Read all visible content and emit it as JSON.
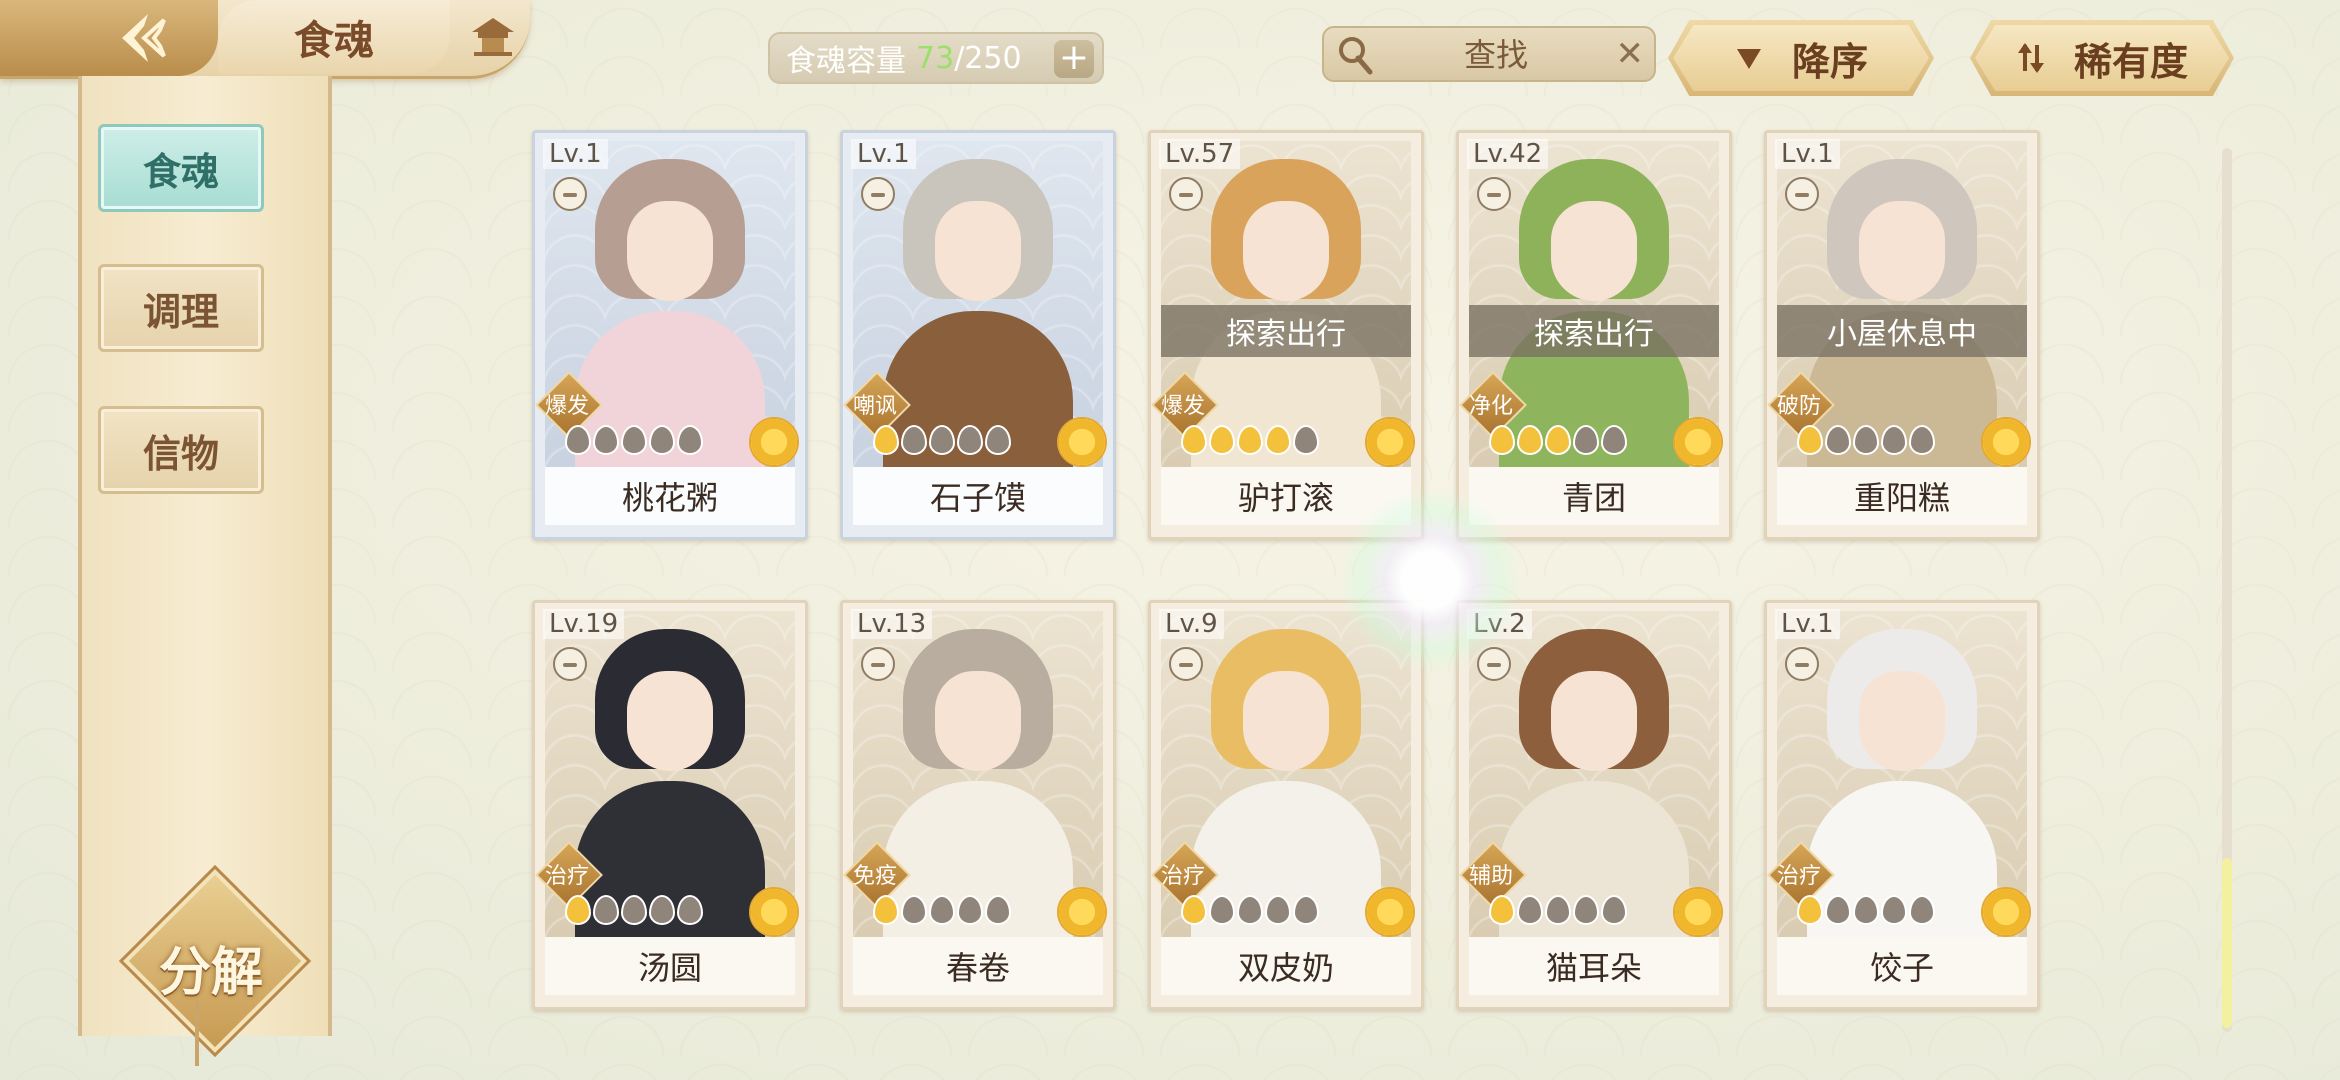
{
  "header": {
    "title": "食魂",
    "capacity_label": "食魂容量",
    "capacity_current": "73",
    "capacity_max": "/250",
    "add_label": "+"
  },
  "search": {
    "placeholder": "查找",
    "clear_label": "✕"
  },
  "sort": {
    "order_label": "降序",
    "rarity_label": "稀有度"
  },
  "sidebar": {
    "tabs": [
      "食魂",
      "调理",
      "信物"
    ],
    "active_tab": "食魂",
    "decompose_label": "分解"
  },
  "colors": {
    "accent_gold": "#c9a56a",
    "active_tab": "#a6ddd2",
    "star_on": "#f3c13c",
    "capacity_current": "#9be06a"
  },
  "cards": [
    {
      "level": "Lv.1",
      "name": "桃花粥",
      "role": "爆发",
      "status": "",
      "stars": 0,
      "theme": "blue",
      "hair": "#b79e92",
      "body": "#f1d4da"
    },
    {
      "level": "Lv.1",
      "name": "石子馍",
      "role": "嘲讽",
      "status": "",
      "stars": 1,
      "theme": "blue",
      "hair": "#c9c4bc",
      "body": "#8a5f3b"
    },
    {
      "level": "Lv.57",
      "name": "驴打滚",
      "role": "爆发",
      "status": "探索出行",
      "stars": 4,
      "theme": "normal",
      "hair": "#d9a35c",
      "body": "#f1e6d2"
    },
    {
      "level": "Lv.42",
      "name": "青团",
      "role": "净化",
      "status": "探索出行",
      "stars": 3,
      "theme": "normal",
      "hair": "#8db25a",
      "body": "#8fb45e"
    },
    {
      "level": "Lv.1",
      "name": "重阳糕",
      "role": "破防",
      "status": "小屋休息中",
      "stars": 1,
      "theme": "normal",
      "hair": "#cfc7be",
      "body": "#cbb996"
    },
    {
      "level": "Lv.19",
      "name": "汤圆",
      "role": "治疗",
      "status": "",
      "stars": 1,
      "theme": "normal",
      "hair": "#2b2b33",
      "body": "#2f2f36"
    },
    {
      "level": "Lv.13",
      "name": "春卷",
      "role": "免疫",
      "status": "",
      "stars": 1,
      "theme": "normal",
      "hair": "#b8ad9f",
      "body": "#f4efe4"
    },
    {
      "level": "Lv.9",
      "name": "双皮奶",
      "role": "治疗",
      "status": "",
      "stars": 1,
      "theme": "normal",
      "hair": "#e9bd64",
      "body": "#f4f1ea"
    },
    {
      "level": "Lv.2",
      "name": "猫耳朵",
      "role": "辅助",
      "status": "",
      "stars": 1,
      "theme": "normal",
      "hair": "#8d5f3c",
      "body": "#ece4d5"
    },
    {
      "level": "Lv.1",
      "name": "饺子",
      "role": "治疗",
      "status": "",
      "stars": 1,
      "theme": "normal",
      "hair": "#ecebea",
      "body": "#f7f6f3"
    }
  ]
}
